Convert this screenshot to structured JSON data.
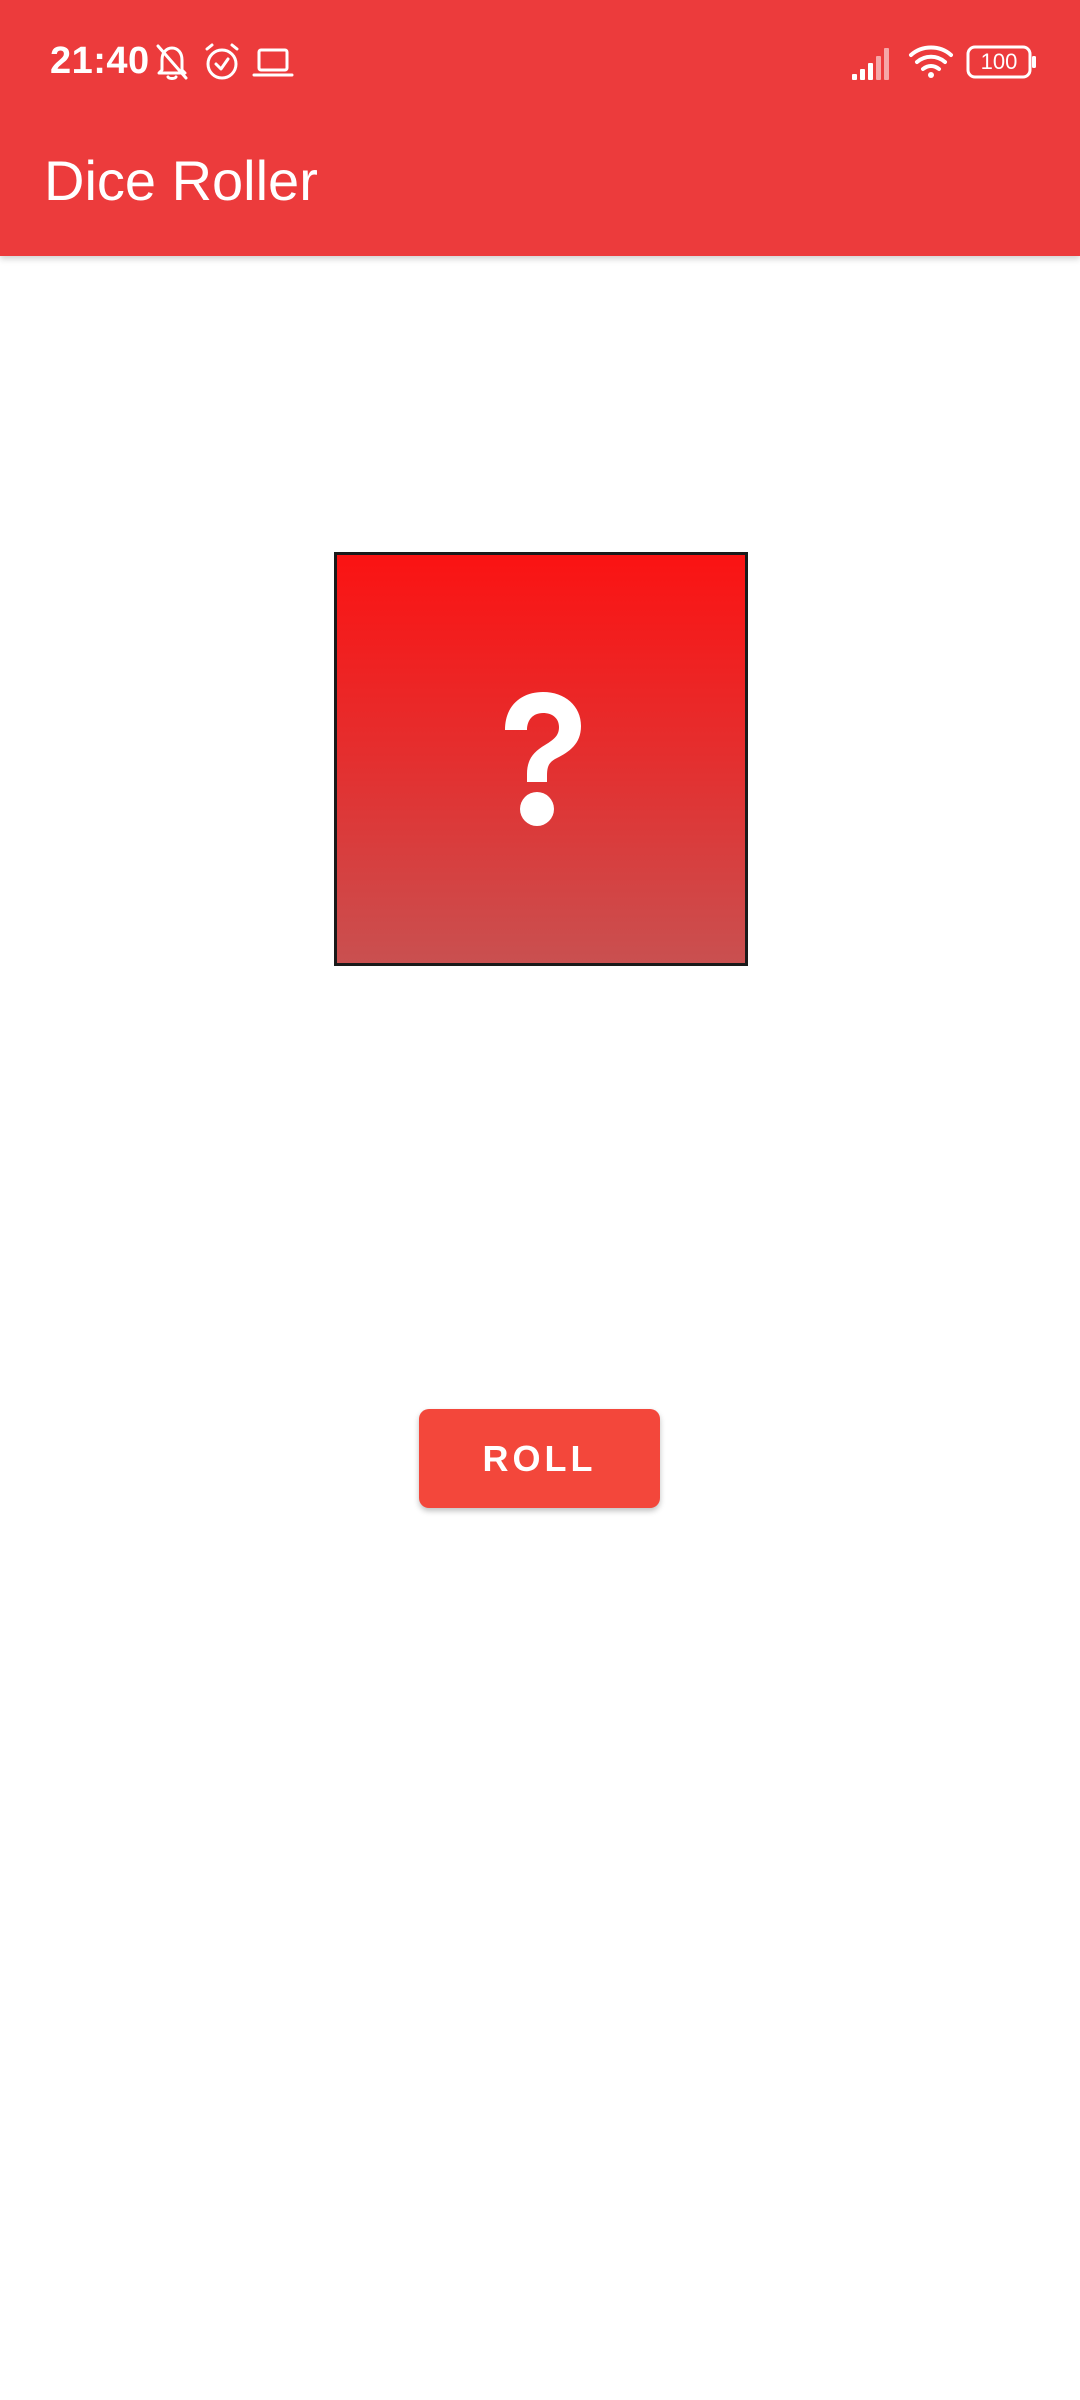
{
  "status_bar": {
    "time": "21:40",
    "battery": "100",
    "icons": [
      "bell-off-icon",
      "alarm-icon",
      "laptop-icon",
      "signal-icon",
      "wifi-icon",
      "battery-icon"
    ]
  },
  "app_bar": {
    "title": "Dice Roller",
    "color": "#ec3b3c"
  },
  "dice": {
    "icon": "question-mark-icon"
  },
  "roll_button": {
    "label": "ROLL",
    "color": "#f3473b"
  }
}
